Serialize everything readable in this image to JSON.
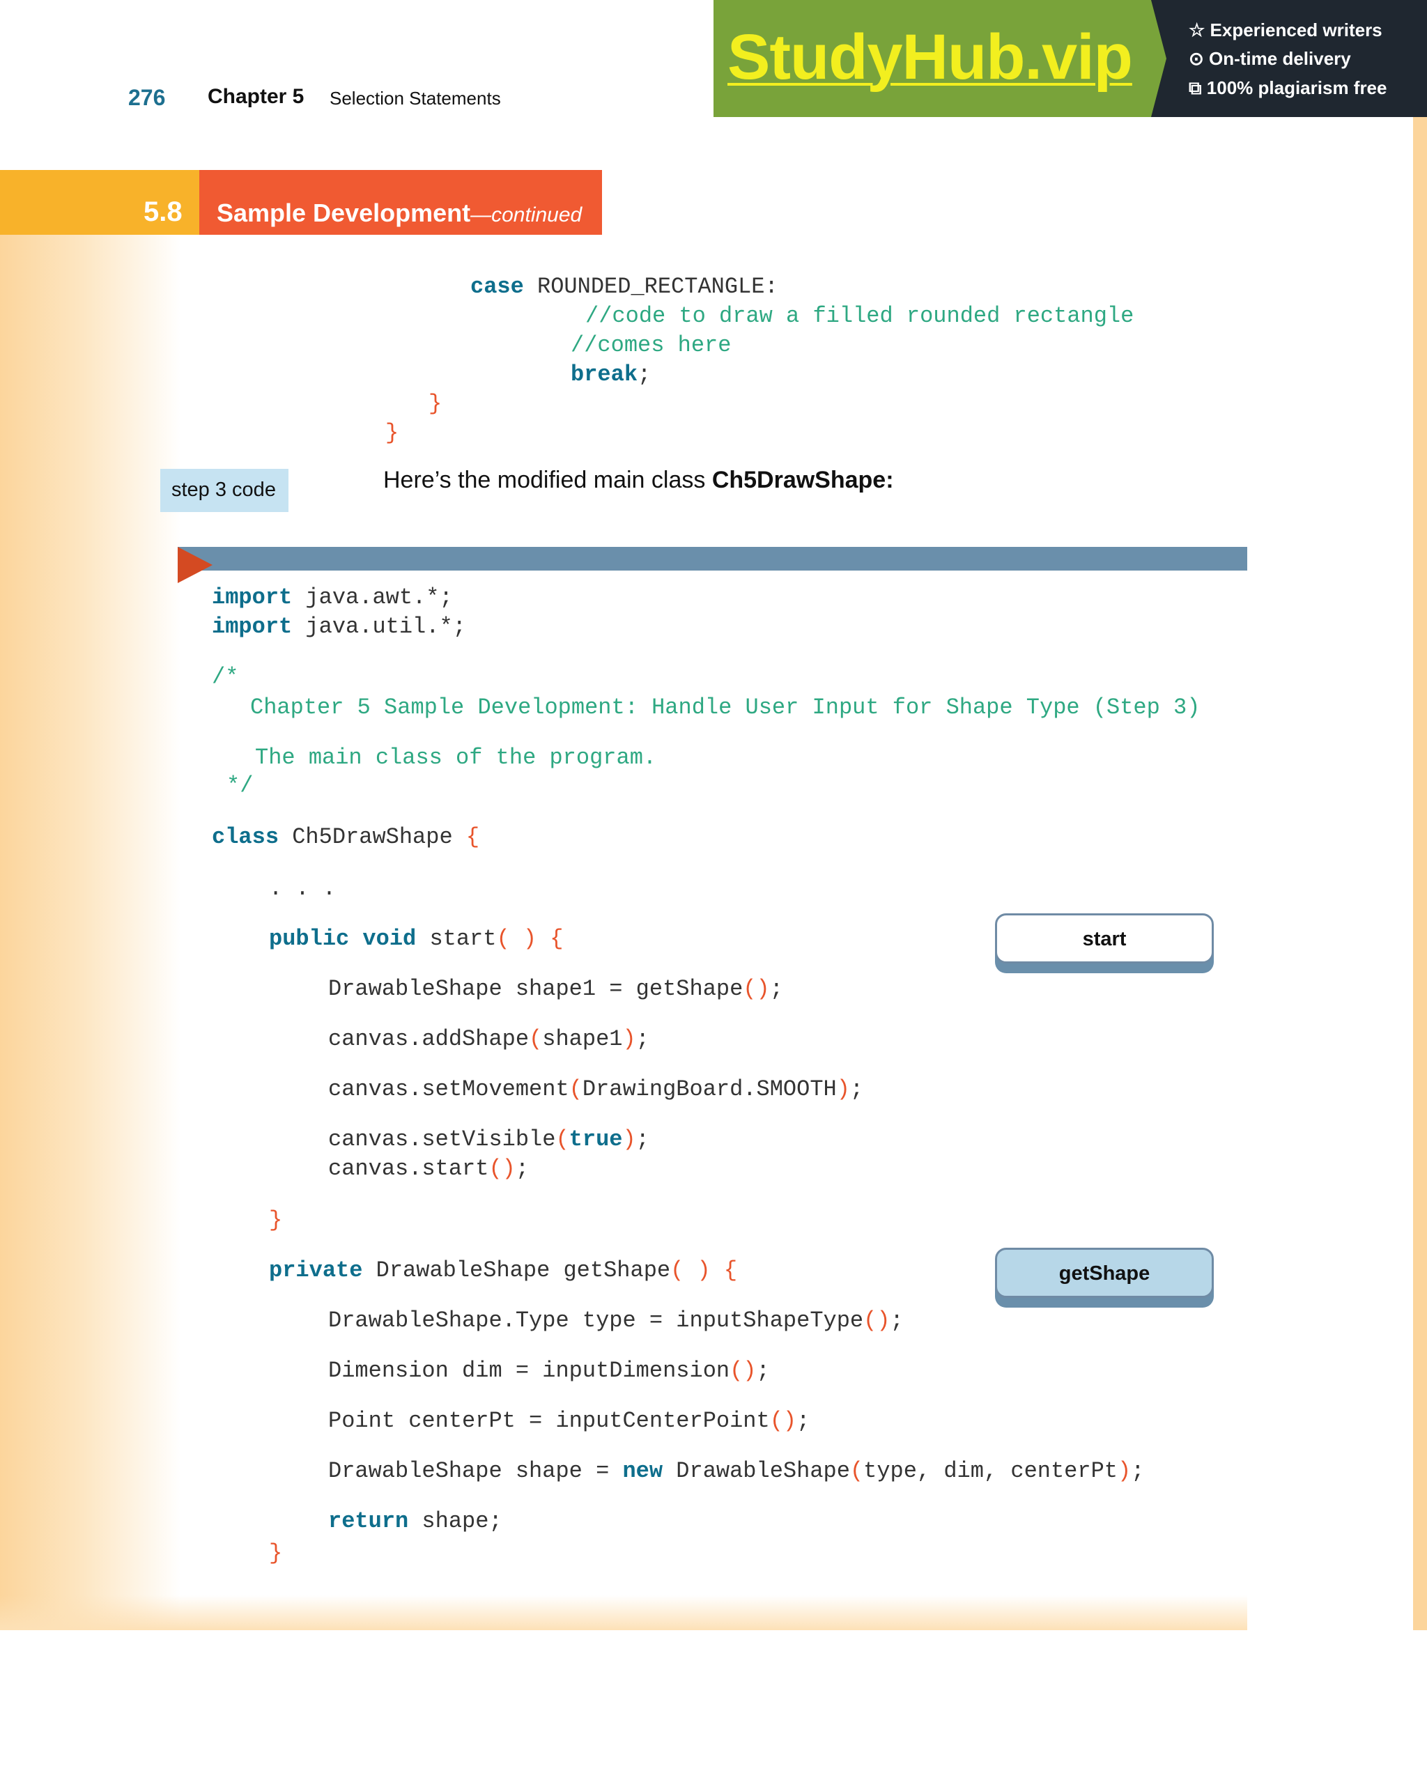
{
  "header": {
    "page_number": "276",
    "chapter_label": "Chapter 5",
    "chapter_title": "Selection Statements"
  },
  "ad": {
    "logo": "StudyHub.vip",
    "lines": [
      "☆ Experienced writers",
      "⊙ On-time delivery",
      "⧉ 100% plagiarism free"
    ]
  },
  "section": {
    "number": "5.8",
    "title": "Sample Development",
    "suffix": "—continued"
  },
  "colors": {
    "keyword": "#0e6e8c",
    "comment": "#2ea882",
    "bracket": "#e8542b",
    "section_orange": "#f05a32",
    "section_yellow": "#f8b22a",
    "code_bar": "#6a8fab"
  },
  "code_top": {
    "case_kw": "case",
    "case_rest": " ROUNDED_RECTANGLE:",
    "comment1": "//code to draw a filled rounded rectangle",
    "comment2": "//comes here",
    "break_kw": "break",
    "break_rest": ";",
    "close1": "}",
    "close2": "}"
  },
  "step_label": "step 3 code",
  "intro": {
    "text": "Here’s the modified main class ",
    "class_name": "Ch5DrawShape:"
  },
  "code_main": {
    "import_kw": "import",
    "import1_rest": " java.awt.*;",
    "import2_rest": " java.util.*;",
    "comment_open": "/*",
    "comment_line1": "Chapter 5 Sample Development: Handle User Input for Shape Type (Step 3)",
    "comment_line2": "The main class of the program.",
    "comment_close": "*/",
    "class_kw": "class",
    "class_name": " Ch5DrawShape ",
    "open_brace": "{",
    "ellipsis": ". . .",
    "public_kw": "public",
    "void_kw": "void",
    "start_name": " start",
    "paren_pair": "( )",
    "shape1_a": "DrawableShape shape1 = getShape",
    "call_empty": "()",
    "semicolon": ";",
    "add_a": "canvas.addShape",
    "add_b": "shape1",
    "move_a": "canvas.setMovement",
    "move_b": "DrawingBoard.SMOOTH",
    "vis_a": "canvas.setVisible",
    "vis_b": "true",
    "start_a": "canvas.start",
    "close_brace": "}",
    "private_kw": "private",
    "getshape_sig": " DrawableShape getShape",
    "type_a": "DrawableShape.Type type = inputShapeType",
    "dim_a": "Dimension dim = inputDimension",
    "pt_a": "Point centerPt = inputCenterPoint",
    "shape_a": "DrawableShape shape = ",
    "new_kw": "new",
    "shape_b": " DrawableShape",
    "shape_args": "type, dim, centerPt",
    "return_kw": "return",
    "return_rest": " shape;",
    "open_paren": "(",
    "close_paren": ")"
  },
  "notes": {
    "start": "start",
    "getshape": "getShape"
  }
}
